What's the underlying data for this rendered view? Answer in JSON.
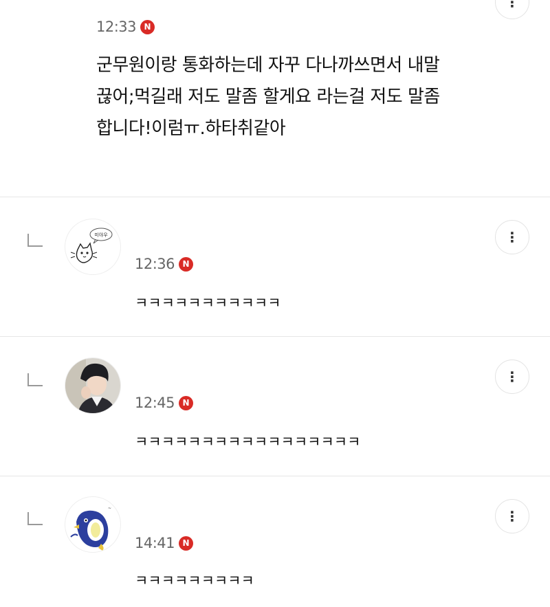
{
  "main_comment": {
    "time": "12:33",
    "badge": "N",
    "text": "군무원이랑 통화하는데 자꾸 다나까쓰면서 내말\n끊어;먹길래 저도 말좀 할게요 라는걸 저도 말좀\n합니다!이럼ㅠ.하타취같아"
  },
  "replies": [
    {
      "avatar": "cat-doodle-avatar",
      "avatar_caption": "미야우",
      "time": "12:36",
      "badge": "N",
      "text": "ㅋㅋㅋㅋㅋㅋㅋㅋㅋㅋㅋ"
    },
    {
      "avatar": "man-portrait-avatar",
      "time": "12:45",
      "badge": "N",
      "text": "ㅋㅋㅋㅋㅋㅋㅋㅋㅋㅋㅋㅋㅋㅋㅋㅋㅋ"
    },
    {
      "avatar": "penguin-doodle-avatar",
      "time": "14:41",
      "badge": "N",
      "text": "ㅋㅋㅋㅋㅋㅋㅋㅋㅋ"
    }
  ],
  "menu_icon": "more-vertical-icon",
  "colors": {
    "badge": "#d92b26",
    "time": "#666666",
    "divider": "#e6e6e6"
  }
}
